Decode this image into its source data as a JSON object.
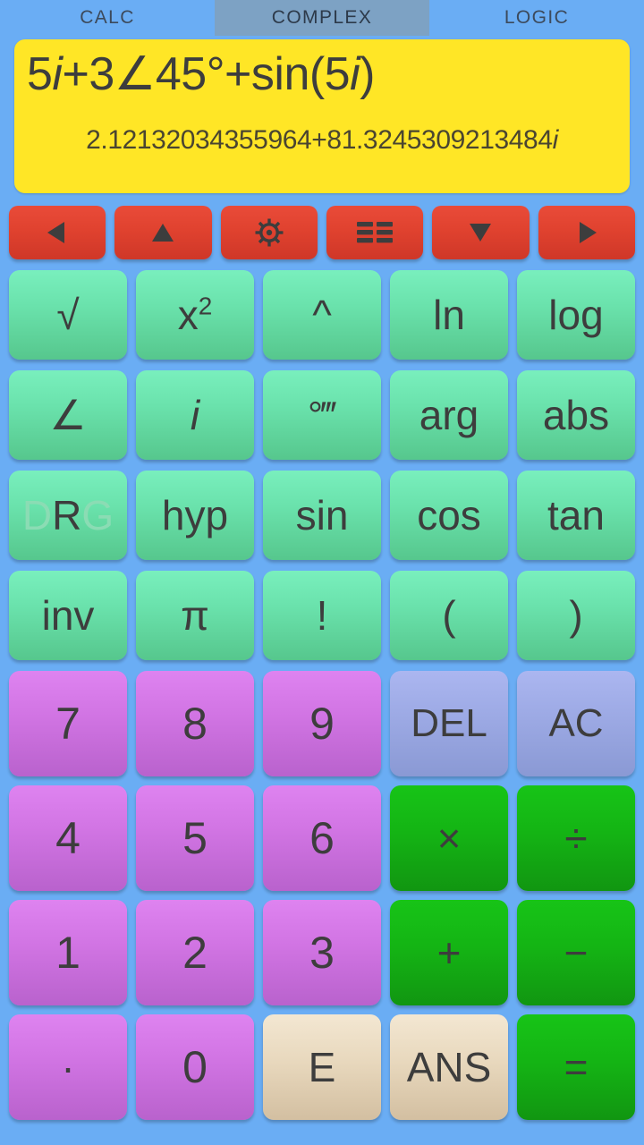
{
  "tabs": [
    {
      "label": "CALC",
      "selected": false
    },
    {
      "label": "COMPLEX",
      "selected": true
    },
    {
      "label": "LOGIC",
      "selected": false
    }
  ],
  "display": {
    "expression": "5i+3∠45°+sin(5i)",
    "expression_parts": [
      {
        "text": "5",
        "italic": false
      },
      {
        "text": "i",
        "italic": true
      },
      {
        "text": "+3∠45°+sin(5",
        "italic": false
      },
      {
        "text": "i",
        "italic": true
      },
      {
        "text": ")",
        "italic": false
      }
    ],
    "result": "2.12132034355964+81.3245309213484i",
    "result_parts": [
      {
        "text": "2.12132034355964+81.3245309213484",
        "italic": false
      },
      {
        "text": "i",
        "italic": true
      }
    ],
    "background_color": "#ffe626"
  },
  "nav_row": [
    {
      "name": "cursor-left",
      "icon": "triangle-left-icon"
    },
    {
      "name": "cursor-up",
      "icon": "triangle-up-icon"
    },
    {
      "name": "settings",
      "icon": "gear-icon"
    },
    {
      "name": "history-list",
      "icon": "list-icon"
    },
    {
      "name": "cursor-down",
      "icon": "triangle-down-icon"
    },
    {
      "name": "cursor-right",
      "icon": "triangle-right-icon"
    }
  ],
  "keys": {
    "row_fn1": [
      {
        "label": "√",
        "name": "sqrt"
      },
      {
        "label": "x²",
        "name": "square",
        "sup": true,
        "base": "x",
        "exp": "2"
      },
      {
        "label": "^",
        "name": "power"
      },
      {
        "label": "ln",
        "name": "ln"
      },
      {
        "label": "log",
        "name": "log"
      }
    ],
    "row_fn2": [
      {
        "label": "∠",
        "name": "angle"
      },
      {
        "label": "i",
        "name": "imaginary-unit",
        "italic": true
      },
      {
        "label": "°‴",
        "name": "degrees-minutes-seconds"
      },
      {
        "label": "arg",
        "name": "arg"
      },
      {
        "label": "abs",
        "name": "abs"
      }
    ],
    "row_fn3": [
      {
        "label": "DRG",
        "name": "drg-mode",
        "segments": [
          {
            "text": "D",
            "active": false
          },
          {
            "text": "R",
            "active": true
          },
          {
            "text": "G",
            "active": false
          }
        ],
        "active_mode": "R"
      },
      {
        "label": "hyp",
        "name": "hyp"
      },
      {
        "label": "sin",
        "name": "sin"
      },
      {
        "label": "cos",
        "name": "cos"
      },
      {
        "label": "tan",
        "name": "tan"
      }
    ],
    "row_fn4": [
      {
        "label": "inv",
        "name": "inv"
      },
      {
        "label": "π",
        "name": "pi"
      },
      {
        "label": "!",
        "name": "factorial"
      },
      {
        "label": "(",
        "name": "open-paren"
      },
      {
        "label": ")",
        "name": "close-paren"
      }
    ],
    "row_num1": [
      {
        "label": "7",
        "name": "digit-7",
        "style": "magenta"
      },
      {
        "label": "8",
        "name": "digit-8",
        "style": "magenta"
      },
      {
        "label": "9",
        "name": "digit-9",
        "style": "magenta"
      },
      {
        "label": "DEL",
        "name": "delete",
        "style": "peri"
      },
      {
        "label": "AC",
        "name": "all-clear",
        "style": "peri"
      }
    ],
    "row_num2": [
      {
        "label": "4",
        "name": "digit-4",
        "style": "magenta"
      },
      {
        "label": "5",
        "name": "digit-5",
        "style": "magenta"
      },
      {
        "label": "6",
        "name": "digit-6",
        "style": "magenta"
      },
      {
        "label": "×",
        "name": "multiply",
        "style": "green"
      },
      {
        "label": "÷",
        "name": "divide",
        "style": "green"
      }
    ],
    "row_num3": [
      {
        "label": "1",
        "name": "digit-1",
        "style": "magenta"
      },
      {
        "label": "2",
        "name": "digit-2",
        "style": "magenta"
      },
      {
        "label": "3",
        "name": "digit-3",
        "style": "magenta"
      },
      {
        "label": "+",
        "name": "plus",
        "style": "green"
      },
      {
        "label": "−",
        "name": "minus",
        "style": "green"
      }
    ],
    "row_num4": [
      {
        "label": "·",
        "name": "decimal-point",
        "style": "magenta"
      },
      {
        "label": "0",
        "name": "digit-0",
        "style": "magenta"
      },
      {
        "label": "E",
        "name": "exponent",
        "style": "cream"
      },
      {
        "label": "ANS",
        "name": "answer",
        "style": "cream"
      },
      {
        "label": "=",
        "name": "equals",
        "style": "green"
      }
    ]
  },
  "colors": {
    "background": "#6aadf4",
    "display_bg": "#ffe626",
    "tab_selected_bg": "#7da2c4",
    "red_key": "#e0422f",
    "mint_key": "#6ae2ac",
    "magenta_key": "#d275e4",
    "periwinkle_key": "#9ca9e4",
    "green_key": "#14b414",
    "cream_key": "#e8d8bd",
    "key_text": "#3d3d3d"
  }
}
